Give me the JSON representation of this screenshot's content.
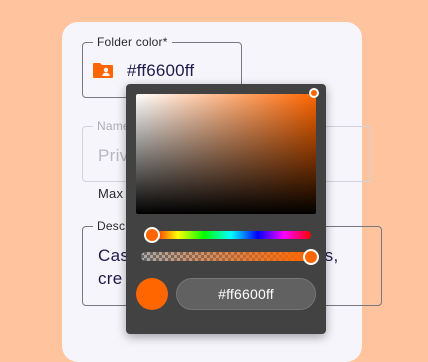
{
  "form": {
    "folder_color": {
      "label": "Folder color*",
      "value": "#ff6600ff",
      "icon": "folder-person-icon",
      "icon_color": "#ff6600"
    },
    "name": {
      "label": "Name",
      "value": "Priv"
    },
    "name_helper": "Max",
    "description": {
      "label": "Desc",
      "value": "Cas",
      "value_suffix": "ans,",
      "value_line2": "cre"
    }
  },
  "color_picker": {
    "selected_color": "#ff6600",
    "hex_value": "#ff6600ff",
    "saturation": 1.0,
    "brightness": 1.0,
    "hue_degrees": 24,
    "alpha": 1.0
  },
  "colors": {
    "background": "#ffc49e",
    "card": "#f6f5fb",
    "picker": "#424242",
    "accent": "#ff6600"
  }
}
